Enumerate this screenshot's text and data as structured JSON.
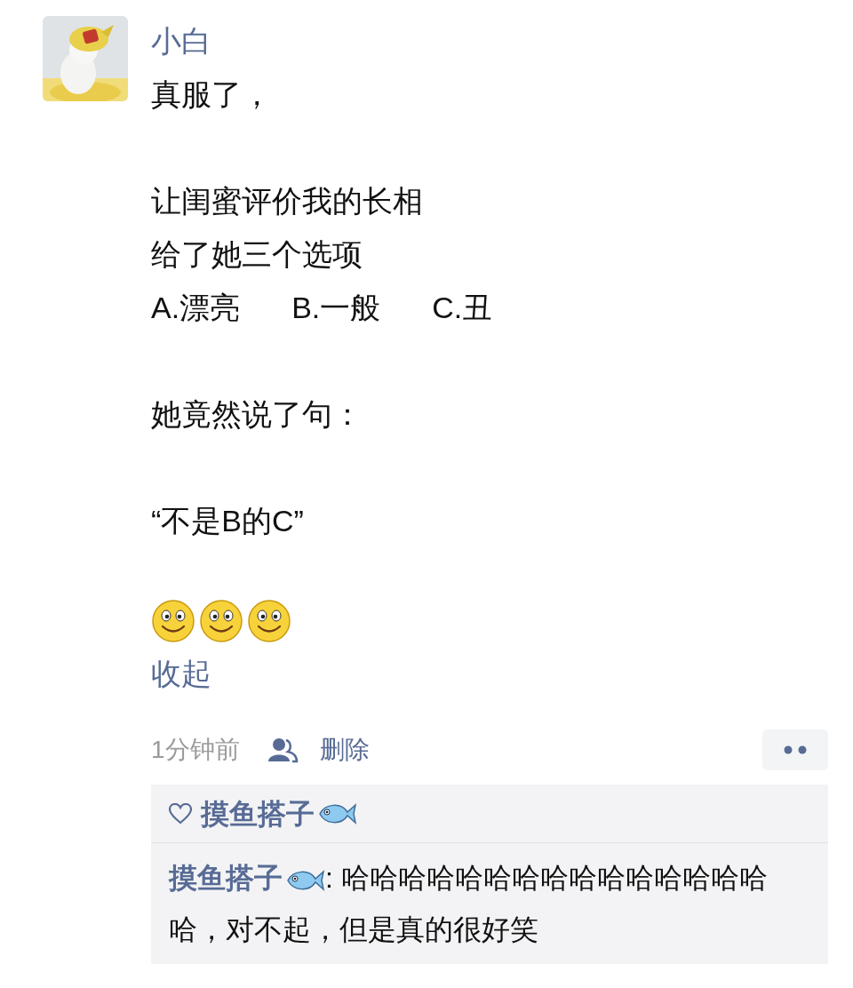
{
  "post": {
    "author": "小白",
    "paragraphs": [
      {
        "lines": [
          {
            "kind": "text",
            "text": "真服了，"
          }
        ]
      },
      {
        "lines": [
          {
            "kind": "text",
            "text": "让闺蜜评价我的长相"
          },
          {
            "kind": "text",
            "text": "给了她三个选项"
          },
          {
            "kind": "options",
            "items": [
              "A.漂亮",
              "B.一般",
              "C.丑"
            ]
          }
        ]
      },
      {
        "lines": [
          {
            "kind": "text",
            "text": "她竟然说了句："
          }
        ]
      },
      {
        "lines": [
          {
            "kind": "text",
            "text": "“不是B的C”"
          }
        ]
      }
    ],
    "emojis": [
      {
        "kind": "smile"
      },
      {
        "kind": "smile"
      },
      {
        "kind": "smile"
      }
    ],
    "collapse_link": "收起",
    "time": "1分钟前",
    "delete_link": "删除"
  },
  "likes": [
    {
      "name": "摸鱼搭子"
    }
  ],
  "comments": [
    {
      "author": "摸鱼搭子",
      "separator": ":",
      "text": "哈哈哈哈哈哈哈哈哈哈哈哈哈哈哈哈，对不起，但是真的很好笑"
    }
  ]
}
